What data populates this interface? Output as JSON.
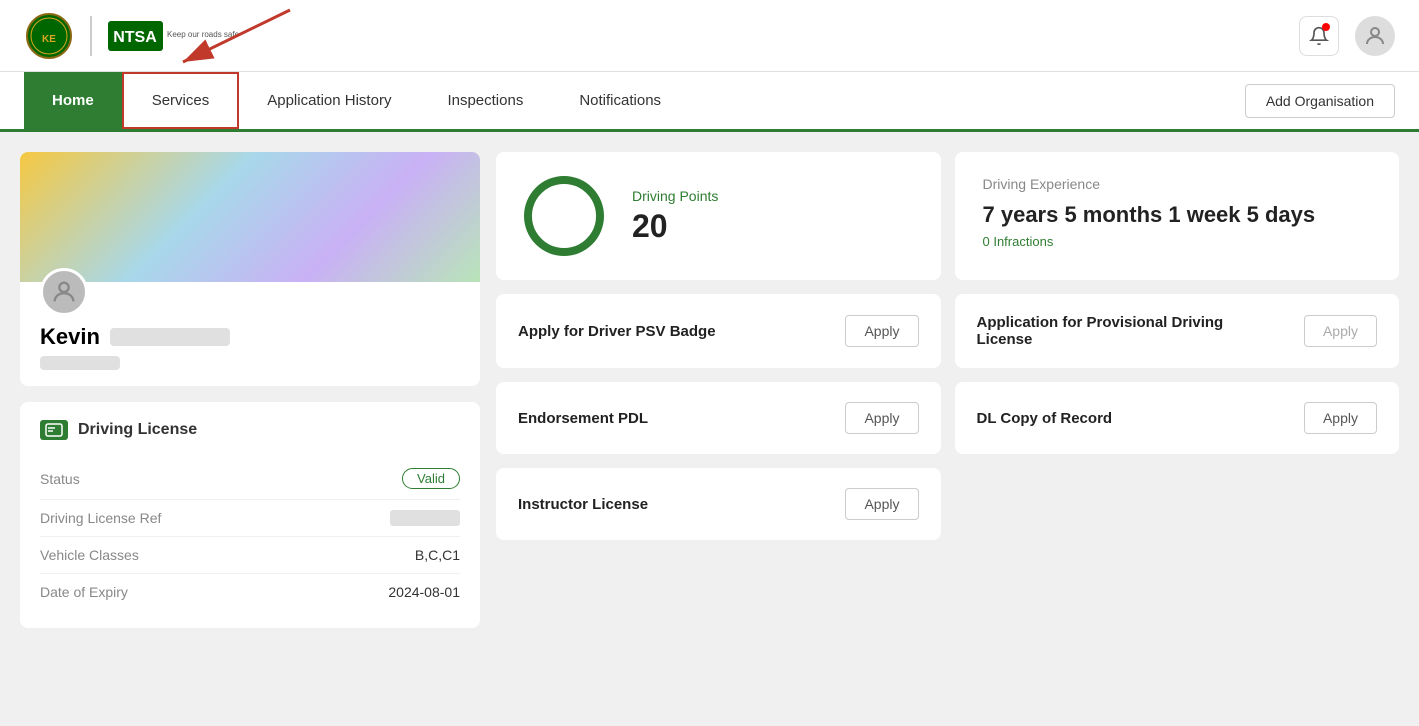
{
  "header": {
    "bell_label": "🔔",
    "add_org_label": "Add Organisation"
  },
  "nav": {
    "home_label": "Home",
    "services_label": "Services",
    "app_history_label": "Application History",
    "inspections_label": "Inspections",
    "notifications_label": "Notifications"
  },
  "profile": {
    "name": "Kevin",
    "status_label": "Status",
    "status_value": "Valid",
    "dl_ref_label": "Driving License Ref",
    "vehicle_classes_label": "Vehicle Classes",
    "vehicle_classes_value": "B,C,C1",
    "date_of_expiry_label": "Date of Expiry",
    "date_of_expiry_value": "2024-08-01",
    "license_section_title": "Driving License"
  },
  "driving_points": {
    "label": "Driving Points",
    "value": "20"
  },
  "driving_experience": {
    "label": "Driving Experience",
    "value": "7 years 5 months 1 week 5 days",
    "infractions": "0 Infractions"
  },
  "services": [
    {
      "name": "Apply for Driver PSV Badge",
      "apply_label": "Apply",
      "disabled": false
    },
    {
      "name": "Application for Provisional Driving License",
      "apply_label": "Apply",
      "disabled": true
    },
    {
      "name": "Endorsement PDL",
      "apply_label": "Apply",
      "disabled": false
    },
    {
      "name": "DL Copy of Record",
      "apply_label": "Apply",
      "disabled": false
    },
    {
      "name": "Instructor License",
      "apply_label": "Apply",
      "disabled": false
    }
  ]
}
